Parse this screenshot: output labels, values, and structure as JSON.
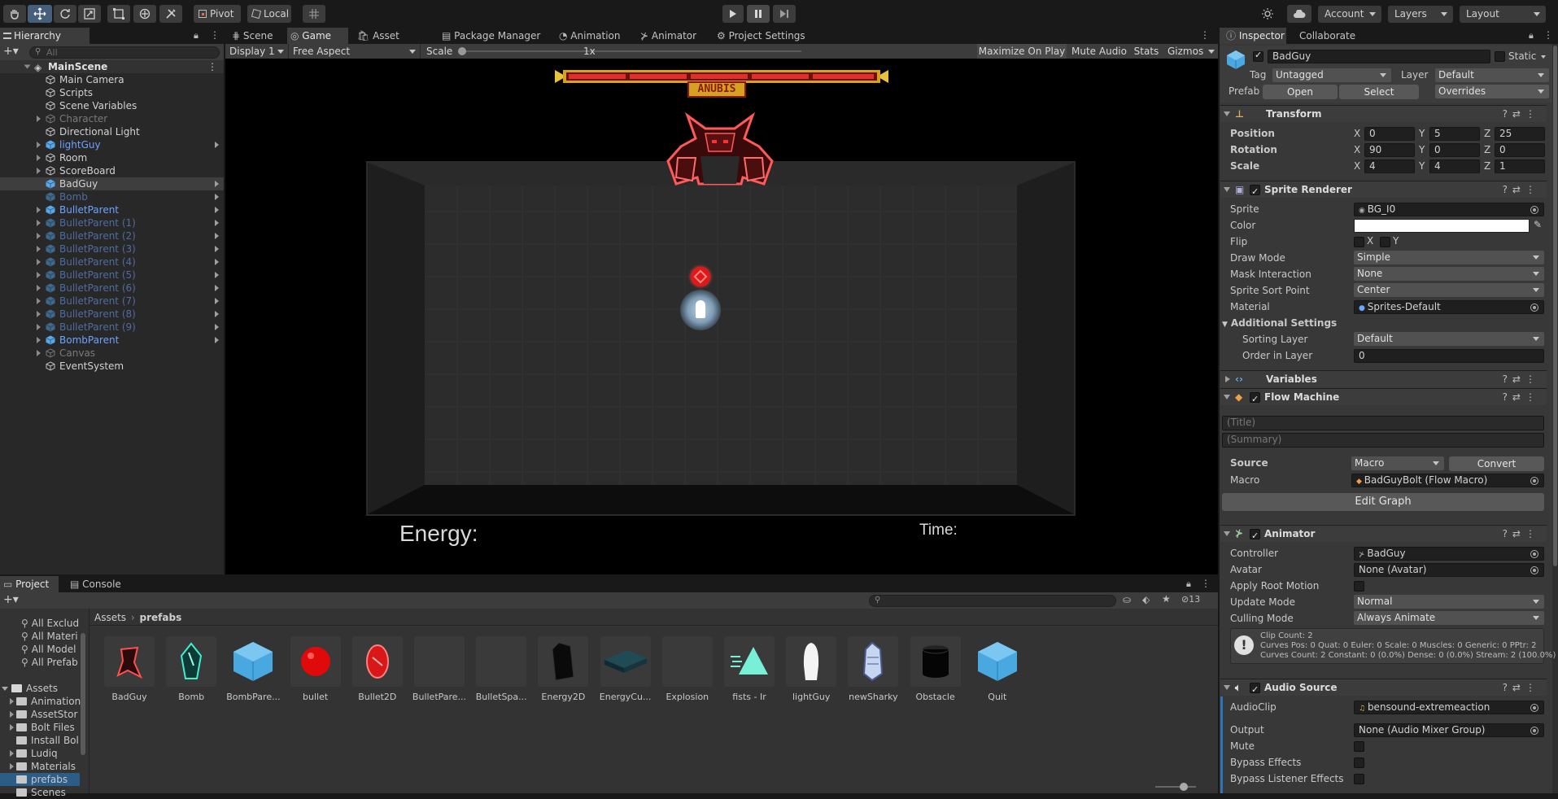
{
  "toolbar": {
    "pivot": "Pivot",
    "local": "Local",
    "account": "Account",
    "layers": "Layers",
    "layout": "Layout"
  },
  "hierarchy": {
    "tab": "Hierarchy",
    "search_placeholder": "All",
    "scene": "MainScene",
    "items": [
      {
        "label": "Main Camera"
      },
      {
        "label": "Scripts"
      },
      {
        "label": "Scene Variables"
      },
      {
        "label": "Character"
      },
      {
        "label": "Directional Light"
      },
      {
        "label": "lightGuy"
      },
      {
        "label": "Room"
      },
      {
        "label": "ScoreBoard"
      },
      {
        "label": "BadGuy"
      },
      {
        "label": "Bomb"
      },
      {
        "label": "BulletParent"
      },
      {
        "label": "BulletParent (1)"
      },
      {
        "label": "BulletParent (2)"
      },
      {
        "label": "BulletParent (3)"
      },
      {
        "label": "BulletParent (4)"
      },
      {
        "label": "BulletParent (5)"
      },
      {
        "label": "BulletParent (6)"
      },
      {
        "label": "BulletParent (7)"
      },
      {
        "label": "BulletParent (8)"
      },
      {
        "label": "BulletParent (9)"
      },
      {
        "label": "BombParent"
      },
      {
        "label": "Canvas"
      },
      {
        "label": "EventSystem"
      }
    ]
  },
  "center_tabs": [
    "Scene",
    "Game",
    "Asset Store",
    "Package Manager",
    "Animation",
    "Animator",
    "Project Settings"
  ],
  "game_bar": {
    "display": "Display 1",
    "aspect": "Free Aspect",
    "scale_label": "Scale",
    "scale_value": "1x",
    "maximize": "Maximize On Play",
    "mute": "Mute Audio",
    "stats": "Stats",
    "gizmos": "Gizmos"
  },
  "game": {
    "boss_name": "ANUBIS",
    "energy_label": "Energy:",
    "time_label": "Time:"
  },
  "project": {
    "tabs": [
      "Project",
      "Console"
    ],
    "hidden_count": "13",
    "breadcrumb_root": "Assets",
    "breadcrumb_current": "prefabs",
    "favorites": [
      "All Exclud",
      "All Materi",
      "All Model",
      "All Prefab"
    ],
    "assets_root": "Assets",
    "folders": [
      "Animation",
      "AssetStor",
      "Bolt Files",
      "Install Bol",
      "Ludiq",
      "Materials",
      "prefabs",
      "Scenes"
    ],
    "assets": [
      "BadGuy",
      "Bomb",
      "BombPare...",
      "bullet",
      "Bullet2D",
      "BulletPare...",
      "BulletSpa...",
      "Energy2D",
      "EnergyCu...",
      "Explosion",
      "fists - Ir",
      "lightGuy",
      "newSharky",
      "Obstacle",
      "Quit"
    ]
  },
  "inspector": {
    "tabs": [
      "Inspector",
      "Collaborate"
    ],
    "object_name": "BadGuy",
    "static_label": "Static",
    "tag_label": "Tag",
    "tag_value": "Untagged",
    "layer_label": "Layer",
    "layer_value": "Default",
    "prefab_label": "Prefab",
    "open": "Open",
    "select": "Select",
    "overrides": "Overrides",
    "transform": {
      "title": "Transform",
      "position": "Position",
      "rotation": "Rotation",
      "scale": "Scale",
      "pos": [
        "0",
        "5",
        "25"
      ],
      "rot": [
        "90",
        "0",
        "0"
      ],
      "scl": [
        "4",
        "4",
        "1"
      ]
    },
    "sprite_renderer": {
      "title": "Sprite Renderer",
      "sprite_label": "Sprite",
      "sprite_value": "BG_I0",
      "color_label": "Color",
      "flip_label": "Flip",
      "flip_x": "X",
      "flip_y": "Y",
      "draw_mode_label": "Draw Mode",
      "draw_mode": "Simple",
      "mask_label": "Mask Interaction",
      "mask": "None",
      "sort_point_label": "Sprite Sort Point",
      "sort_point": "Center",
      "material_label": "Material",
      "material": "Sprites-Default",
      "additional": "Additional Settings",
      "sorting_layer_label": "Sorting Layer",
      "sorting_layer": "Default",
      "order_label": "Order in Layer",
      "order": "0"
    },
    "variables": {
      "title": "Variables"
    },
    "flow_machine": {
      "title": "Flow Machine",
      "title_placeholder": "(Title)",
      "summary_placeholder": "(Summary)",
      "source_label": "Source",
      "source": "Macro",
      "convert": "Convert",
      "macro_label": "Macro",
      "macro": "BadGuyBolt (Flow Macro)",
      "edit_graph": "Edit Graph"
    },
    "animator": {
      "title": "Animator",
      "controller_label": "Controller",
      "controller": "BadGuy",
      "avatar_label": "Avatar",
      "avatar": "None (Avatar)",
      "root_motion_label": "Apply Root Motion",
      "update_mode_label": "Update Mode",
      "update_mode": "Normal",
      "culling_label": "Culling Mode",
      "culling": "Always Animate",
      "info1": "Clip Count: 2",
      "info2": "Curves Pos: 0 Quat: 0 Euler: 0 Scale: 0 Muscles: 0 Generic: 0 PPtr: 2",
      "info3": "Curves Count: 2 Constant: 0 (0.0%) Dense: 0 (0.0%) Stream: 2 (100.0%)"
    },
    "audio_source": {
      "title": "Audio Source",
      "clip_label": "AudioClip",
      "clip": "bensound-extremeaction",
      "output_label": "Output",
      "output": "None (Audio Mixer Group)",
      "mute_label": "Mute",
      "bypass_label": "Bypass Effects",
      "bypass_listener_label": "Bypass Listener Effects"
    }
  },
  "colors": {
    "accent": "#46607c",
    "prefab_blue": "#6ea2ff",
    "selection": "#2c5d87"
  }
}
